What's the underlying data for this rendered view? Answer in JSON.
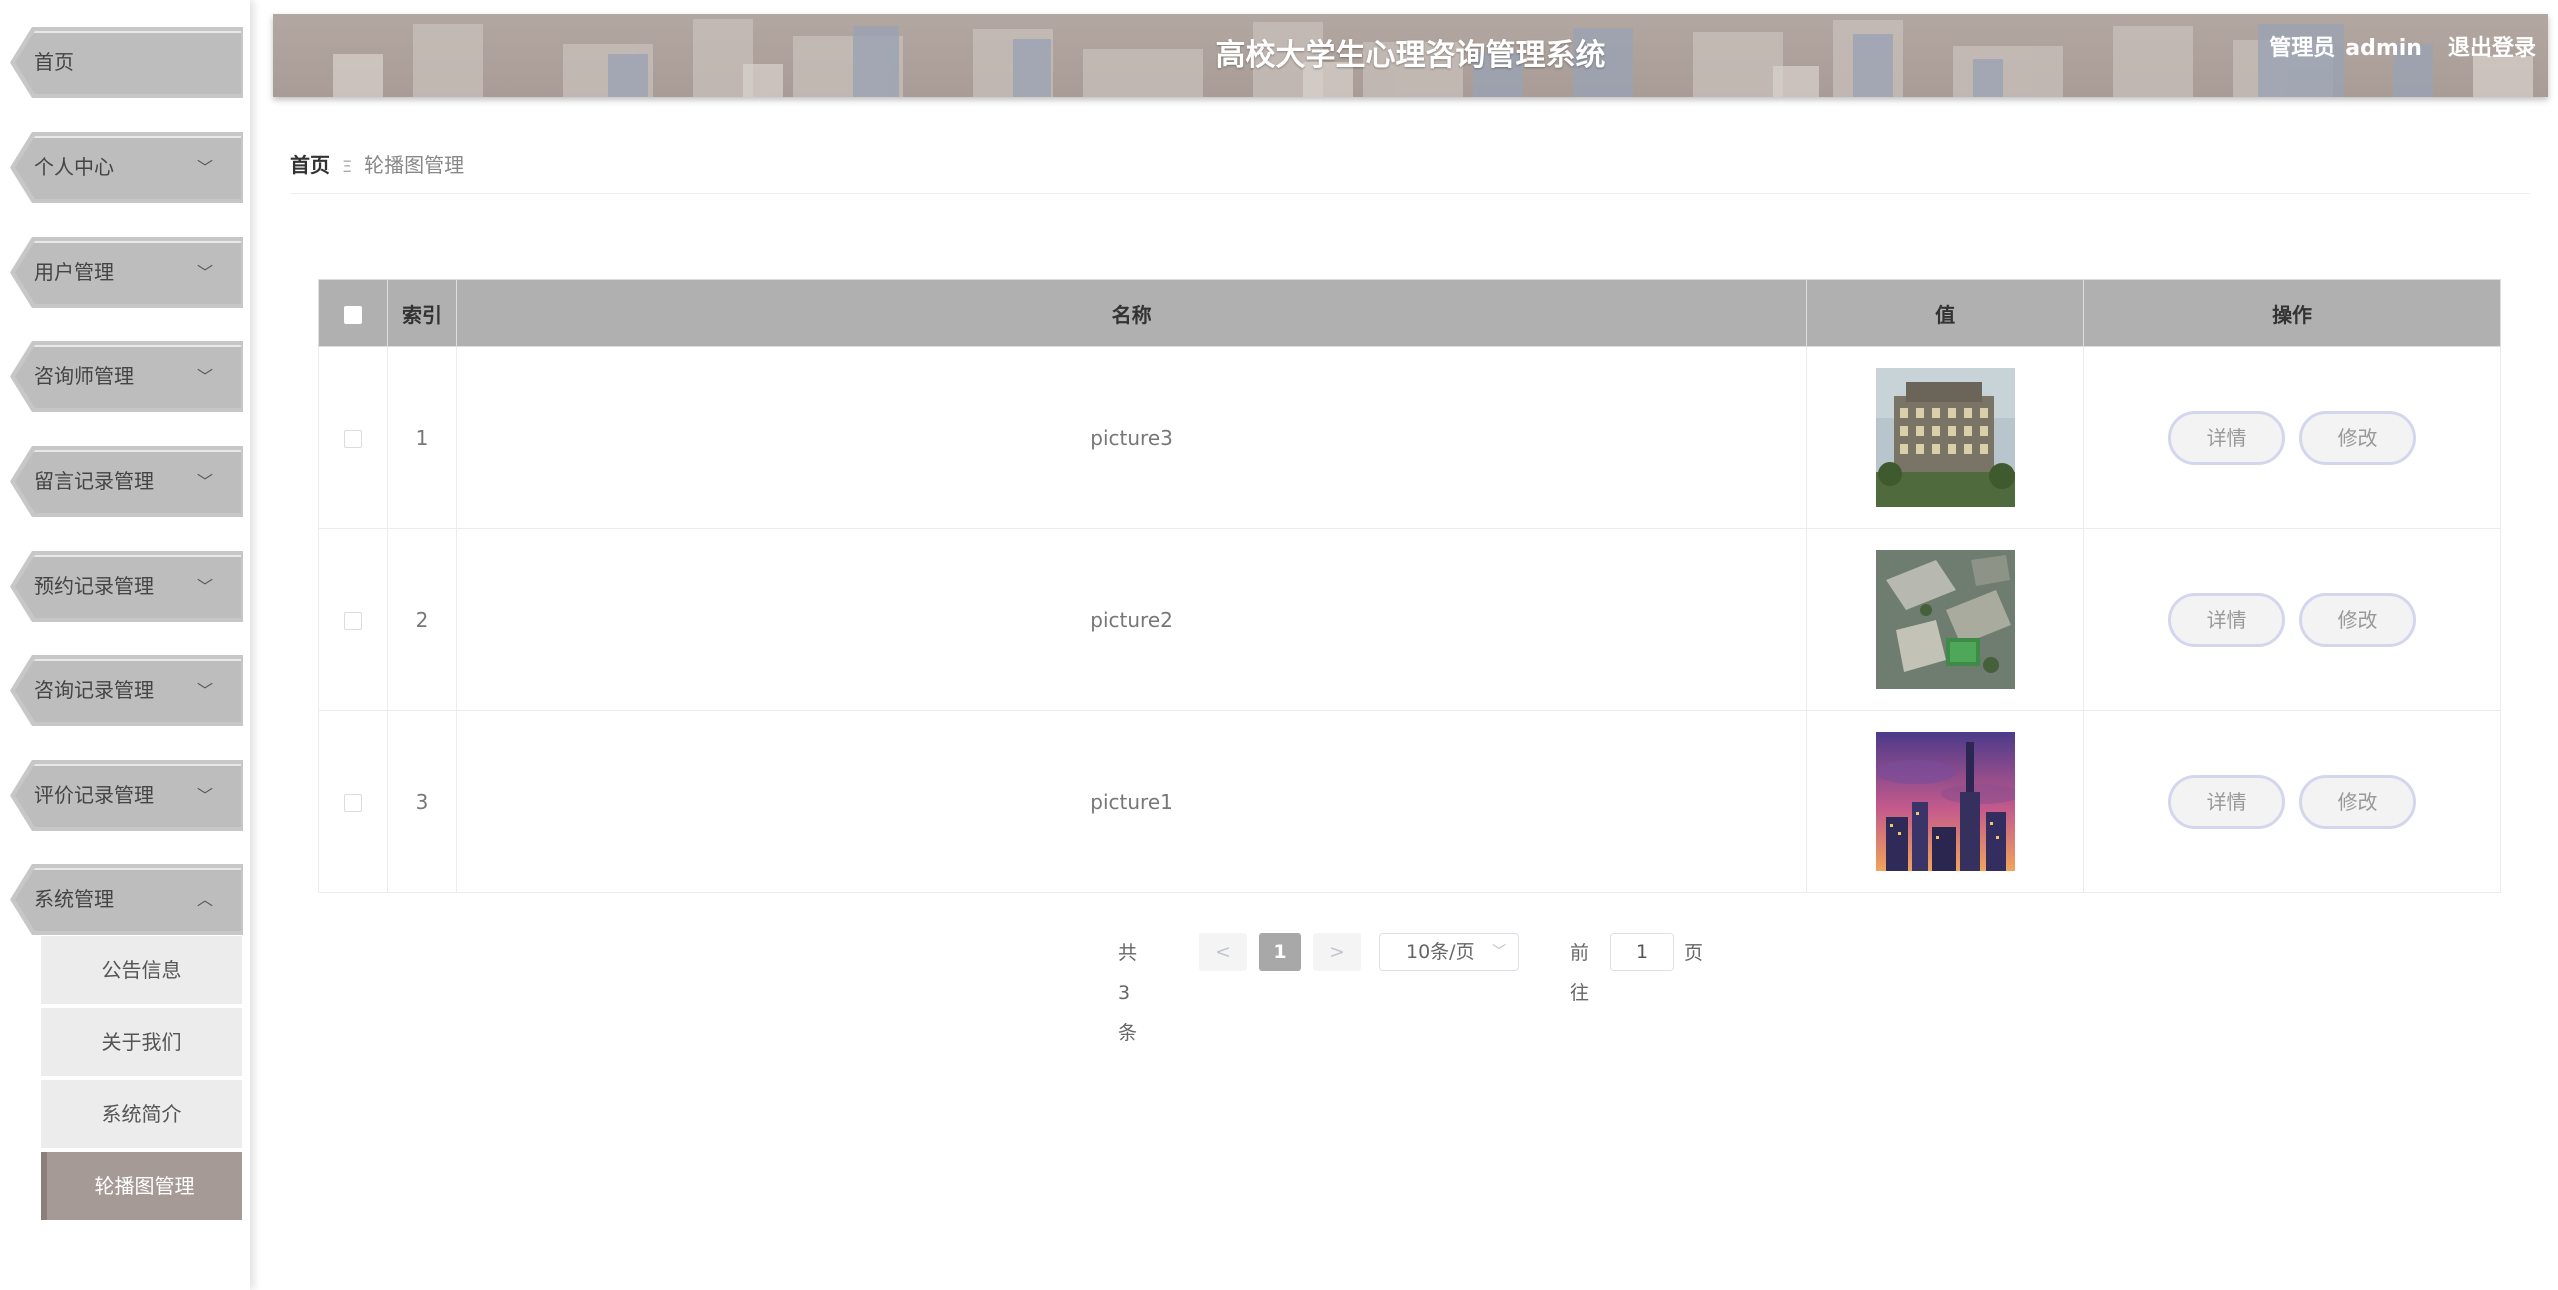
{
  "sidebar": {
    "items": [
      {
        "label": "首页",
        "chevron": ""
      },
      {
        "label": "个人中心",
        "chevron": "﹀"
      },
      {
        "label": "用户管理",
        "chevron": "﹀"
      },
      {
        "label": "咨询师管理",
        "chevron": "﹀"
      },
      {
        "label": "留言记录管理",
        "chevron": "﹀"
      },
      {
        "label": "预约记录管理",
        "chevron": "﹀"
      },
      {
        "label": "咨询记录管理",
        "chevron": "﹀"
      },
      {
        "label": "评价记录管理",
        "chevron": "﹀"
      },
      {
        "label": "系统管理",
        "chevron": "︿"
      }
    ],
    "submenu": [
      {
        "label": "公告信息"
      },
      {
        "label": "关于我们"
      },
      {
        "label": "系统简介"
      },
      {
        "label": "轮播图管理"
      }
    ]
  },
  "header": {
    "title": "高校大学生心理咨询管理系统",
    "role": "管理员",
    "username": "admin",
    "logout": "退出登录"
  },
  "breadcrumb": {
    "home": "首页",
    "separator": "Ξ",
    "current": "轮播图管理"
  },
  "table": {
    "columns": {
      "index": "索引",
      "name": "名称",
      "value": "值",
      "actions": "操作"
    },
    "rows": [
      {
        "index": "1",
        "name": "picture3",
        "image": "building-photo",
        "detail": "详情",
        "edit": "修改"
      },
      {
        "index": "2",
        "name": "picture2",
        "image": "campus-aerial-photo",
        "detail": "详情",
        "edit": "修改"
      },
      {
        "index": "3",
        "name": "picture1",
        "image": "city-sunset-illustration",
        "detail": "详情",
        "edit": "修改"
      }
    ]
  },
  "pagination": {
    "total": "共 3 条",
    "prev": "<",
    "current_page": "1",
    "next": ">",
    "page_size": "10条/页",
    "goto_label": "前往",
    "goto_value": "1",
    "page_suffix": "页"
  },
  "colors": {
    "header_bg": "#ab9e98",
    "sidebar_tab": "#bdbdbd",
    "submenu_active": "#a59a96",
    "table_header": "#b0b0b0",
    "button_border": "#d4d6ee"
  }
}
